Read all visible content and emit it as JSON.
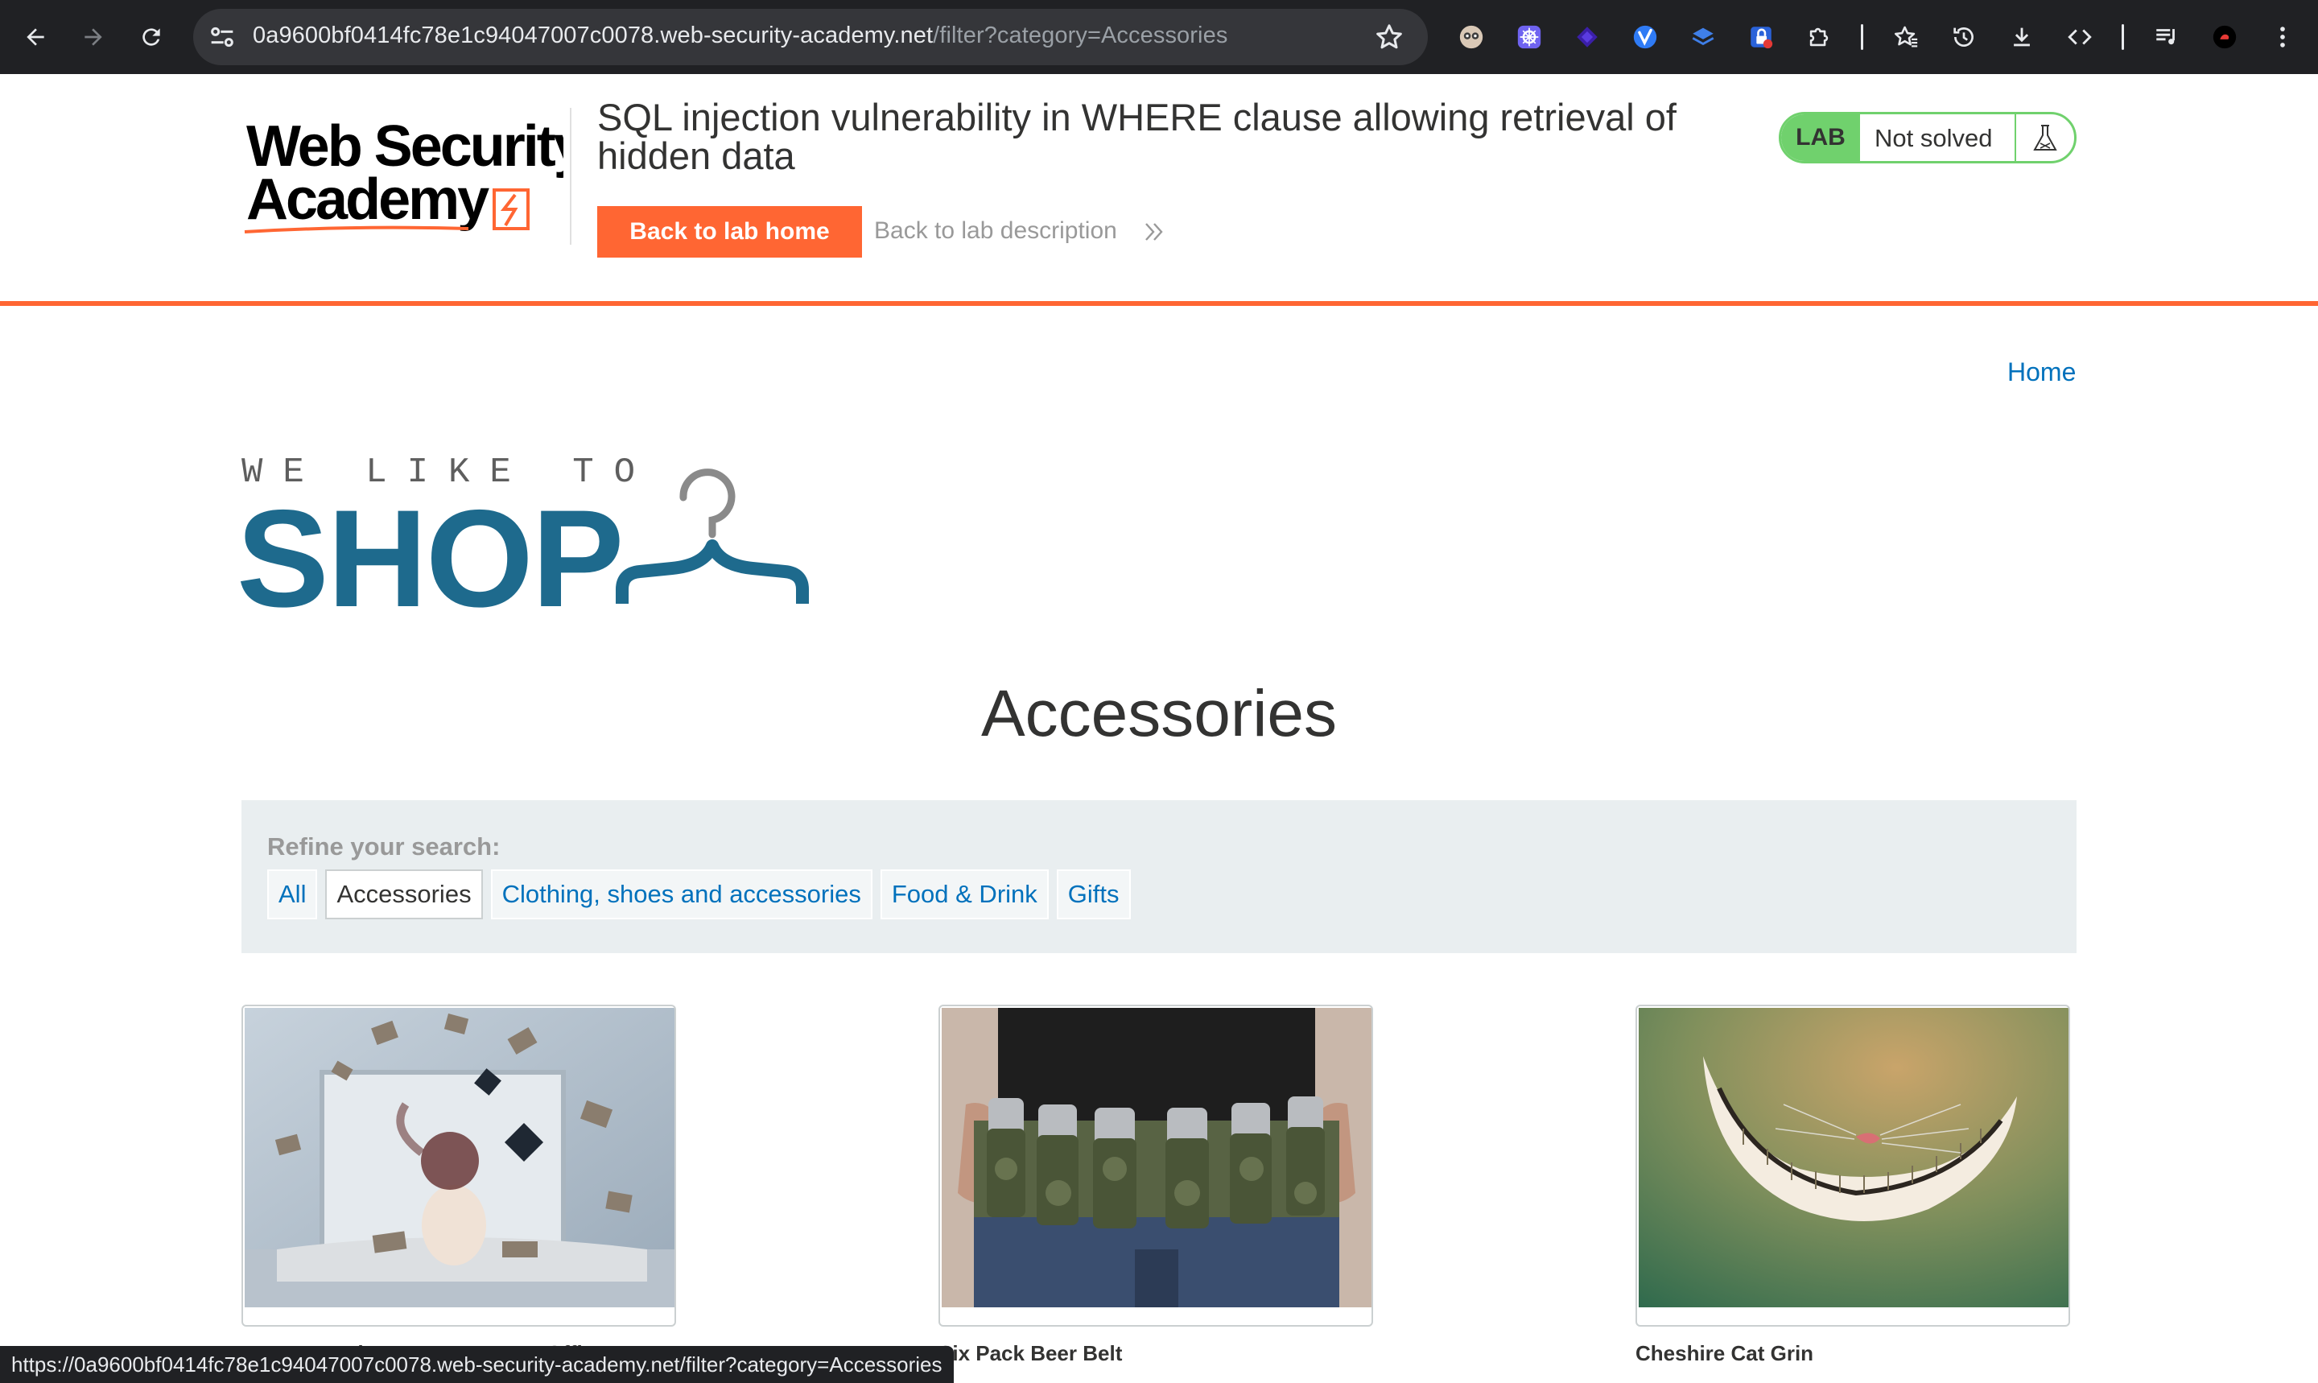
{
  "browser": {
    "url_host": "0a9600bf0414fc78e1c94047007c0078.web-security-academy.net",
    "url_path": "/filter?category=Accessories",
    "status_url": "https://0a9600bf0414fc78e1c94047007c0078.web-security-academy.net/filter?category=Accessories",
    "nav_icons": [
      "back-icon",
      "forward-icon",
      "reload-icon"
    ],
    "extension_icons": [
      "sandbox-icon",
      "hub-icon",
      "shield-icon",
      "v-icon",
      "stack-icon",
      "lock-icon",
      "puzzle-icon"
    ],
    "toolbar_icons": [
      "favorites-icon",
      "history-icon",
      "download-icon",
      "devtools-icon",
      "media-icon",
      "profile-icon",
      "menu-icon"
    ]
  },
  "lab": {
    "logo_line1": "Web Security",
    "logo_line2": "Academy",
    "title": "SQL injection vulnerability in WHERE clause allowing retrieval of hidden data",
    "back_home": "Back to lab home",
    "back_description": "Back to lab description",
    "status_tag": "LAB",
    "status_text": "Not solved"
  },
  "shop": {
    "home_link": "Home",
    "logo_small": "WE LIKE TO",
    "logo_big": "SHOP",
    "category_title": "Accessories",
    "refine_label": "Refine your search:",
    "filters": [
      {
        "label": "All",
        "active": false
      },
      {
        "label": "Accessories",
        "active": true
      },
      {
        "label": "Clothing, shoes and accessories",
        "active": false
      },
      {
        "label": "Food & Drink",
        "active": false
      },
      {
        "label": "Gifts",
        "active": false
      }
    ],
    "products": [
      {
        "name": "ZZZZZZ Bed - Your New Home Office"
      },
      {
        "name": "Six Pack Beer Belt"
      },
      {
        "name": "Cheshire Cat Grin"
      }
    ]
  },
  "colors": {
    "accent": "#ff6633",
    "lab_green": "#70d16d",
    "link": "#0071bc",
    "shop_blue": "#1e6a8d",
    "filter_bg": "#e9eef0"
  }
}
